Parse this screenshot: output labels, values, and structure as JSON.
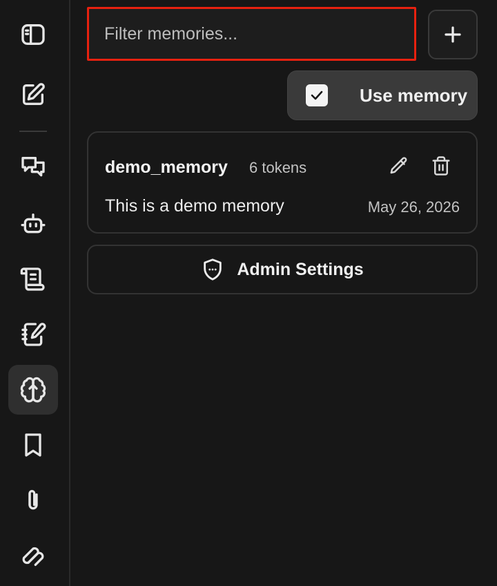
{
  "sidebar": {
    "items": [
      {
        "name": "sidebar-toggle",
        "icon": "sidebar-panel-icon"
      },
      {
        "name": "new-chat",
        "icon": "edit-square-icon"
      },
      {
        "name": "chats",
        "icon": "chat-bubbles-icon"
      },
      {
        "name": "agents",
        "icon": "robot-icon"
      },
      {
        "name": "prompts",
        "icon": "scroll-icon"
      },
      {
        "name": "notes",
        "icon": "notebook-pen-icon"
      },
      {
        "name": "memories",
        "icon": "brain-icon",
        "active": true
      },
      {
        "name": "bookmarks",
        "icon": "bookmark-icon"
      },
      {
        "name": "attachments",
        "icon": "paperclip-icon"
      },
      {
        "name": "more",
        "icon": "chain-link-icon"
      }
    ]
  },
  "memories": {
    "filter_placeholder": "Filter memories...",
    "filter_value": "",
    "use_memory_label": "Use memory",
    "use_memory_checked": true,
    "list": [
      {
        "name": "demo_memory",
        "tokens": "6 tokens",
        "content": "This is a demo memory",
        "date": "May 26, 2026"
      }
    ],
    "admin_settings_label": "Admin Settings"
  },
  "colors": {
    "background": "#171717",
    "highlight_border": "#e8210f",
    "active_item": "#2f2f2f"
  }
}
